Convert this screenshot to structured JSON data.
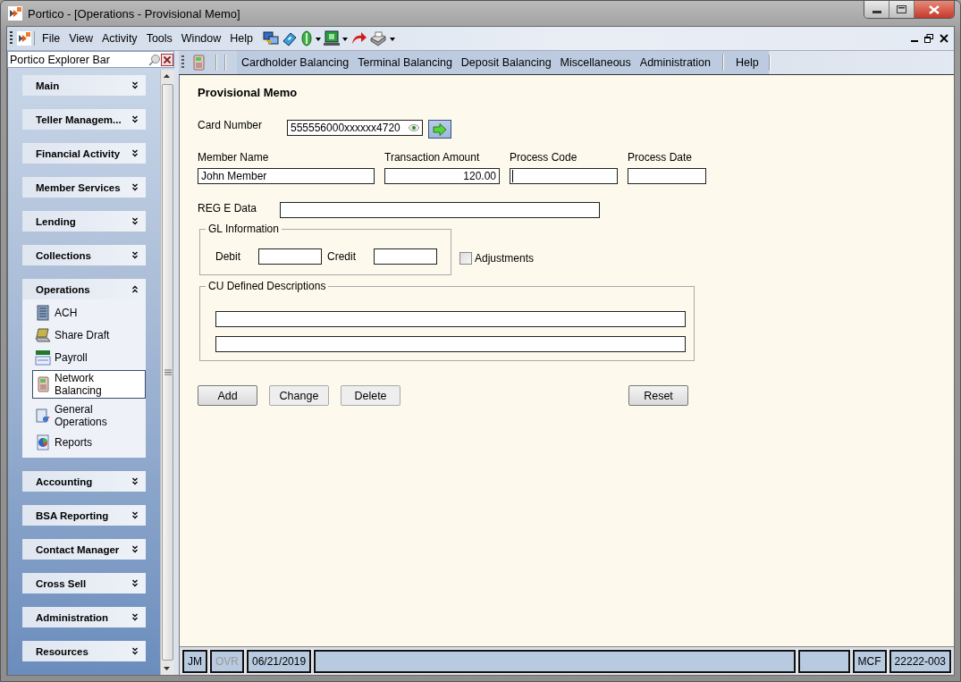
{
  "window": {
    "title": "Portico - [Operations - Provisional Memo]"
  },
  "menu": [
    "File",
    "View",
    "Activity",
    "Tools",
    "Window",
    "Help"
  ],
  "explorer": {
    "title": "Portico Explorer Bar",
    "groups": [
      {
        "label": "Main",
        "expanded": false
      },
      {
        "label": "Teller Managem...",
        "expanded": false
      },
      {
        "label": "Financial Activity",
        "expanded": false
      },
      {
        "label": "Member Services",
        "expanded": false
      },
      {
        "label": "Lending",
        "expanded": false
      },
      {
        "label": "Collections",
        "expanded": false
      },
      {
        "label": "Operations",
        "expanded": true,
        "items": [
          {
            "label": "ACH",
            "selected": false
          },
          {
            "label": "Share Draft",
            "selected": false
          },
          {
            "label": "Payroll",
            "selected": false
          },
          {
            "label": "Network Balancing",
            "selected": true
          },
          {
            "label": "General Operations",
            "selected": false
          },
          {
            "label": "Reports",
            "selected": false
          }
        ]
      },
      {
        "label": "Accounting",
        "expanded": false
      },
      {
        "label": "BSA Reporting",
        "expanded": false
      },
      {
        "label": "Contact Manager",
        "expanded": false
      },
      {
        "label": "Cross Sell",
        "expanded": false
      },
      {
        "label": "Administration",
        "expanded": false
      },
      {
        "label": "Resources",
        "expanded": false
      }
    ]
  },
  "module_menu": [
    "Cardholder Balancing",
    "Terminal Balancing",
    "Deposit Balancing",
    "Miscellaneous",
    "Administration",
    "Help"
  ],
  "form": {
    "title": "Provisional Memo",
    "card_number": {
      "label": "Card Number",
      "value": "555556000xxxxxx4720"
    },
    "fields": [
      {
        "label": "Member Name",
        "value": "John Member",
        "kind": "text",
        "focused": false
      },
      {
        "label": "Transaction Amount",
        "value": "120.00",
        "kind": "amount",
        "focused": false
      },
      {
        "label": "Process Code",
        "kind": "text",
        "focused": true
      },
      {
        "label": "Process Date",
        "kind": "text",
        "focused": false
      }
    ],
    "reg_e": {
      "label": "REG E Data"
    },
    "gl": {
      "title": "GL Information",
      "debit_label": "Debit",
      "credit_label": "Credit"
    },
    "adjustments": {
      "label": "Adjustments",
      "checked": false
    },
    "cu_descriptions": {
      "title": "CU Defined Descriptions"
    },
    "buttons": [
      {
        "label": "Add",
        "kind": "action",
        "disabled": false
      },
      {
        "label": "Change",
        "kind": "action",
        "disabled": true
      },
      {
        "label": "Delete",
        "kind": "action",
        "disabled": true
      },
      {
        "label": "Reset",
        "kind": "reset",
        "disabled": false
      }
    ]
  },
  "status_bar": [
    {
      "kind": "text",
      "text": "JM",
      "disabled": false
    },
    {
      "kind": "text",
      "text": "OVR",
      "disabled": true
    },
    {
      "kind": "text",
      "text": "06/21/2019",
      "disabled": false
    },
    {
      "kind": "blank"
    },
    {
      "kind": "blank"
    },
    {
      "kind": "text",
      "text": "MCF",
      "disabled": false
    },
    {
      "kind": "text",
      "text": "22222-003",
      "disabled": false
    }
  ]
}
